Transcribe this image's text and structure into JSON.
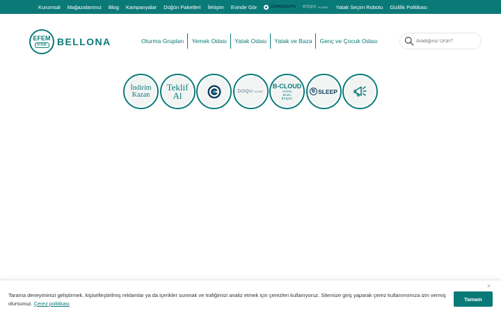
{
  "topbar": {
    "links": [
      "Kurumsal",
      "Mağazalarımız",
      "Blog",
      "Kampanyalar",
      "Düğün Paketleri",
      "İletişim",
      "Evinde Gör"
    ],
    "brand1": "GÜNÜŞSUYU",
    "brand2": "DOQU",
    "brand2_sub": "HOME",
    "links2": [
      "Yatak Seçim Robotu",
      "Gizlilik Politikası"
    ]
  },
  "logo": {
    "efem": "EFEM",
    "home": "HOME",
    "word": "BELLONA"
  },
  "nav": {
    "items": [
      "Oturma Grupları",
      "Yemek Odası",
      "Yatak Odası",
      "Yatak ve Baza",
      "Genç ve Çocuk Odası"
    ]
  },
  "search": {
    "placeholder": "Aradığınız Ürün?"
  },
  "circles": {
    "indirim": [
      "İndirim",
      "Kazan"
    ],
    "teklif": [
      "Teklif",
      "Al"
    ],
    "doqu": "DOQU",
    "doqu_sub": "HOME",
    "bcloud": "B-CLOUD",
    "bcloud_sub": [
      "YATAK",
      "BAZA",
      "BAŞLIK"
    ],
    "bsleep_badge": "B",
    "bsleep": "SLEEP"
  },
  "cookie": {
    "text": "Tarama deneyiminizi geliştirmek, kişiselleştirilmiş reklamlar ya da içerikler sunmak ve trafiğimizi analiz etmek için çerezleri kullanıyoruz. Sitemize giriş yaparak çerez kullanımımıza izin vermiş olursunuz.",
    "link": "Çerez politikası",
    "button": "Tamam",
    "close": "×"
  },
  "colors": {
    "brand": "#0a7a78",
    "navy": "#0b3b5a"
  }
}
